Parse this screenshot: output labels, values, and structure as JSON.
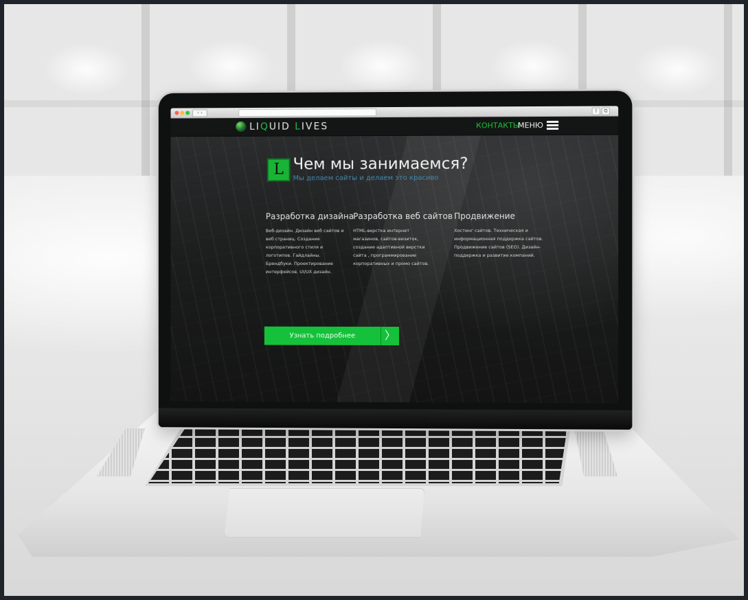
{
  "browser": {
    "nav_arrows": "‹ ›",
    "share_glyph": "⇪",
    "tabs_glyph": "⧉"
  },
  "site": {
    "logo": {
      "part1": "LI",
      "accent": "Q",
      "part2": "UID ",
      "accent2": "L",
      "part3": "IVES"
    },
    "nav": {
      "contacts": "КОНТАКТЫ",
      "menu": "МЕНЮ"
    },
    "hero": {
      "icon_letter": "L",
      "title": "Чем мы занимаемся?",
      "subtitle": "Мы делаем сайты и делаем это красиво",
      "columns": [
        {
          "title": "Разработка дизайна",
          "text": "Веб-дизайн. Дизайн веб сайтов и веб страниц. Создание корпоративного стиля и логотипов. Гайдлайны. Брендбуки. Проектирование интерфейсов. UI/UX дизайн."
        },
        {
          "title": "Разработка веб сайтов",
          "text": "HTML-верстка интернет магазинов, сайтов-визиток, создание адаптивной верстки сайта , программирование корпоративных и промо сайтов."
        },
        {
          "title": "Продвижение",
          "text": "Хостинг сайтов. Техническая и информационная поддержка сайтов. Продвижение сайтов (SEO). Дизайн-поддержка и развитие компаний."
        }
      ],
      "cta_label": "Узнать подробнее",
      "cta_arrow": "〉"
    }
  },
  "colors": {
    "accent_green": "#15c13b",
    "subtitle_blue": "#3f8bb0",
    "header_bg": "#141515"
  }
}
